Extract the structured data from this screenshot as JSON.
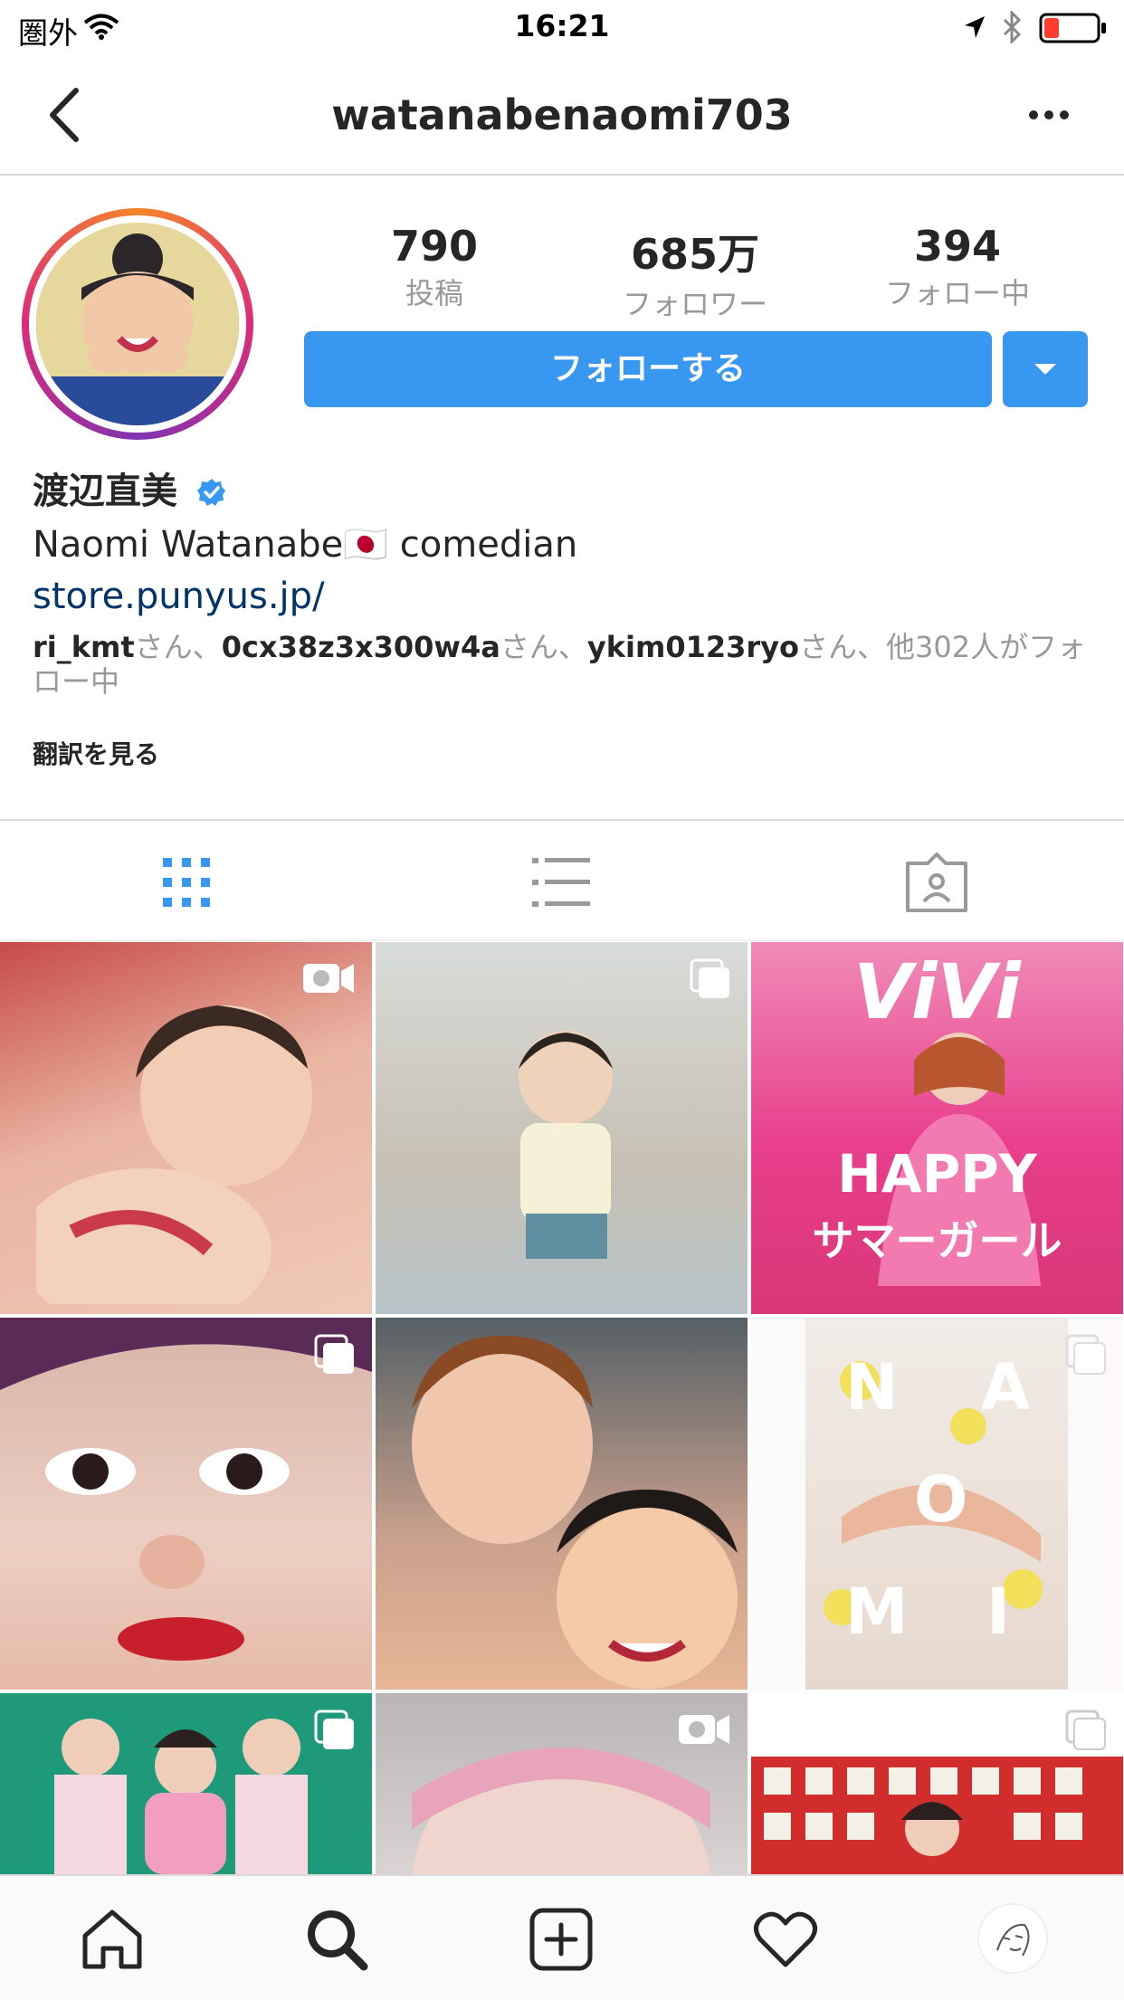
{
  "status_bar": {
    "carrier": "圏外",
    "time": "16:21"
  },
  "header": {
    "username": "watanabenaomi703"
  },
  "profile": {
    "stats": [
      {
        "value": "790",
        "label": "投稿"
      },
      {
        "value": "685万",
        "label": "フォロワー"
      },
      {
        "value": "394",
        "label": "フォロー中"
      }
    ],
    "follow_label": "フォローする",
    "display_name": "渡辺直美",
    "bio_name": "Naomi Watanabe",
    "bio_flag": "🇯🇵",
    "bio_role": "comedian",
    "link": "store.punyus.jp/",
    "followed_by": {
      "user1": "ri_kmt",
      "user2": "0cx38z3x300w4a",
      "user3": "ykim0123ryo",
      "sep": "さん、",
      "rest": "さん、他302人がフォロー中"
    },
    "translate_label": "翻訳を見る"
  },
  "grid": {
    "tiles": [
      {
        "badge": "video",
        "colors": [
          "#c74a4a",
          "#f0c9b8"
        ]
      },
      {
        "badge": "multi",
        "colors": [
          "#cdd3d6",
          "#e9e4d8"
        ]
      },
      {
        "badge": "none",
        "colors": [
          "#e83e8c",
          "#f7a9c9"
        ],
        "texts": [
          "ViVi",
          "HAPPY",
          "サマーガール"
        ]
      },
      {
        "badge": "multi",
        "colors": [
          "#d8b9b0",
          "#f3dfd4"
        ]
      },
      {
        "badge": "none",
        "colors": [
          "#6b4b3d",
          "#e8b596"
        ]
      },
      {
        "badge": "multi",
        "colors": [
          "#f4f1ee",
          "#e9ddd3"
        ],
        "texts": [
          "N",
          "A",
          "O",
          "M",
          "I"
        ]
      },
      {
        "badge": "multi",
        "colors": [
          "#1e9a7a",
          "#f1c6d6"
        ]
      },
      {
        "badge": "video",
        "colors": [
          "#c9c3c4",
          "#ecd2d7"
        ]
      },
      {
        "badge": "multi",
        "colors": [
          "#d22d2d",
          "#ffffff"
        ]
      }
    ]
  },
  "icons": {
    "accent": "#3897f0",
    "link": "#003569",
    "verified": "#3897f0"
  }
}
